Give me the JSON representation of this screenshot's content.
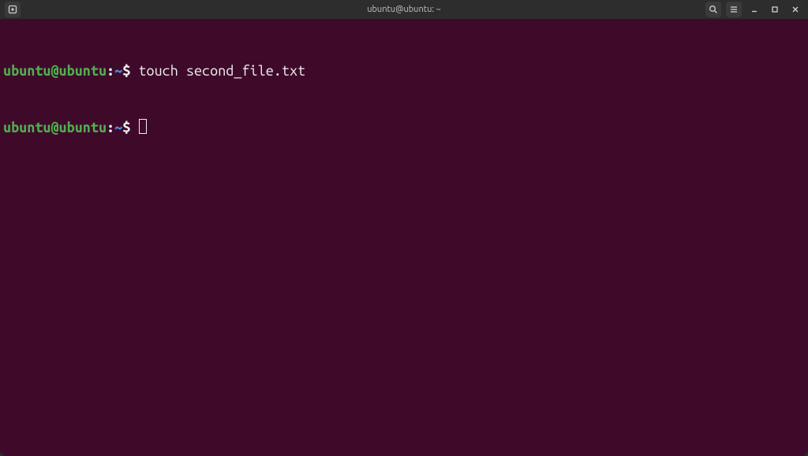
{
  "titlebar": {
    "title": "ubuntu@ubuntu: ~"
  },
  "terminal": {
    "prompt": {
      "user_host": "ubuntu@ubuntu",
      "separator": ":",
      "path": "~",
      "symbol": "$"
    },
    "lines": [
      {
        "command": "touch second_file.txt"
      },
      {
        "command": ""
      }
    ]
  },
  "icons": {
    "new_tab": "new-tab-icon",
    "search": "search-icon",
    "menu": "hamburger-menu-icon",
    "minimize": "minimize-icon",
    "maximize": "maximize-icon",
    "close": "close-icon"
  }
}
